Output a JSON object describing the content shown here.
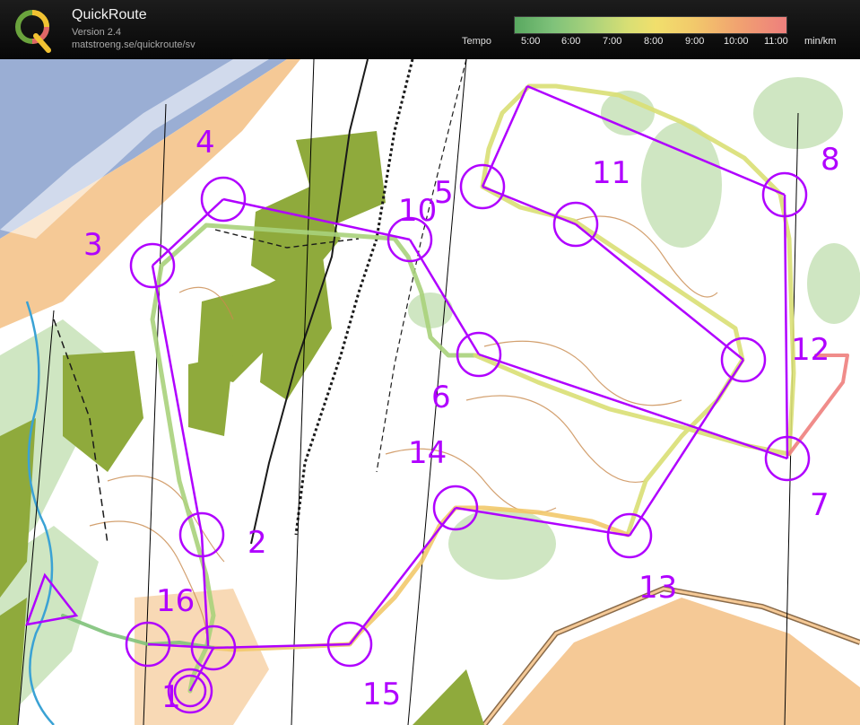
{
  "app": {
    "title": "QuickRoute",
    "version": "Version 2.4",
    "url": "matstroeng.se/quickroute/sv"
  },
  "tempo": {
    "label": "Tempo",
    "ticks": [
      "5:00",
      "6:00",
      "7:00",
      "8:00",
      "9:00",
      "10:00",
      "11:00"
    ],
    "unit": "min/km",
    "gradient_colors": [
      "#59a860",
      "#a9d27b",
      "#f1df6c",
      "#f2c96b",
      "#ee7f7d"
    ]
  },
  "map": {
    "colors": {
      "course": "#b000ff",
      "water": "#9aaed4",
      "forest_green": "#8faa3c",
      "light_green": "#cfe6c2",
      "open_land": "#f5c996",
      "contour": "#c98a4d"
    },
    "controls": [
      {
        "label": "1"
      },
      {
        "label": "2"
      },
      {
        "label": "3"
      },
      {
        "label": "4"
      },
      {
        "label": "5"
      },
      {
        "label": "6"
      },
      {
        "label": "7"
      },
      {
        "label": "8"
      },
      {
        "label": "10"
      },
      {
        "label": "11"
      },
      {
        "label": "12"
      },
      {
        "label": "13"
      },
      {
        "label": "14"
      },
      {
        "label": "15"
      },
      {
        "label": "16"
      }
    ]
  }
}
